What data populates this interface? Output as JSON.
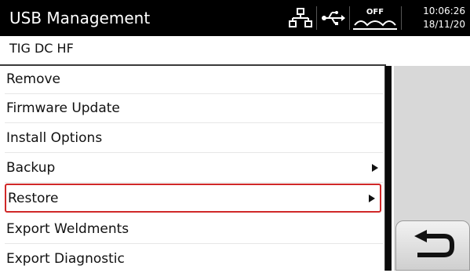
{
  "header": {
    "title": "USB Management",
    "icons": [
      "network-icon",
      "usb-icon",
      "wire-feed-off-icon"
    ],
    "off_label": "OFF",
    "time": "10:06:26",
    "date": "18/11/20"
  },
  "process": "TIG  DC  HF",
  "menu": {
    "items": [
      {
        "label": "Remove",
        "has_submenu": false,
        "selected": false
      },
      {
        "label": "Firmware Update",
        "has_submenu": false,
        "selected": false
      },
      {
        "label": "Install Options",
        "has_submenu": false,
        "selected": false
      },
      {
        "label": "Backup",
        "has_submenu": true,
        "selected": false
      },
      {
        "label": "Restore",
        "has_submenu": true,
        "selected": true
      },
      {
        "label": "Export Weldments",
        "has_submenu": false,
        "selected": false
      },
      {
        "label": "Export Diagnostic",
        "has_submenu": false,
        "selected": false
      }
    ]
  },
  "colors": {
    "header_bg": "#000000",
    "selection_border": "#d02828",
    "panel_bg": "#d8d8d8"
  },
  "back_button": {
    "icon": "back-arrow-icon"
  }
}
